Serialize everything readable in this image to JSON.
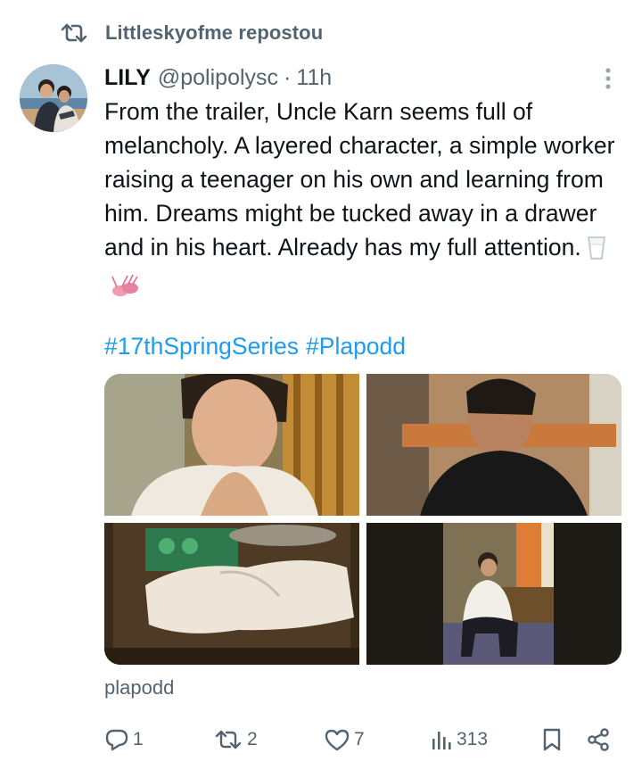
{
  "repost": {
    "text": "Littleskyofme repostou"
  },
  "tweet": {
    "name": "LILY",
    "handle": "@polipolysc",
    "separator": "·",
    "time": "11h",
    "text": "From the trailer, Uncle Karn seems full of melancholy. A layered character, a simple worker raising a teenager on his own and learning from him. Dreams might be tucked away in a drawer and in his heart. Already has my full attention.",
    "hashtags": [
      "#17thSpringSeries",
      "#Plapodd"
    ],
    "source": "plapodd"
  },
  "actions": {
    "replies": "1",
    "reposts": "2",
    "likes": "7",
    "views": "313"
  },
  "colors": {
    "link": "#1d9bf0",
    "muted": "#536471",
    "text": "#0f1419"
  },
  "icons": [
    "repost-icon",
    "more-icon",
    "glass-emoji",
    "ballet-shoes-emoji",
    "reply-icon",
    "like-icon",
    "views-icon",
    "bookmark-icon",
    "share-icon"
  ]
}
